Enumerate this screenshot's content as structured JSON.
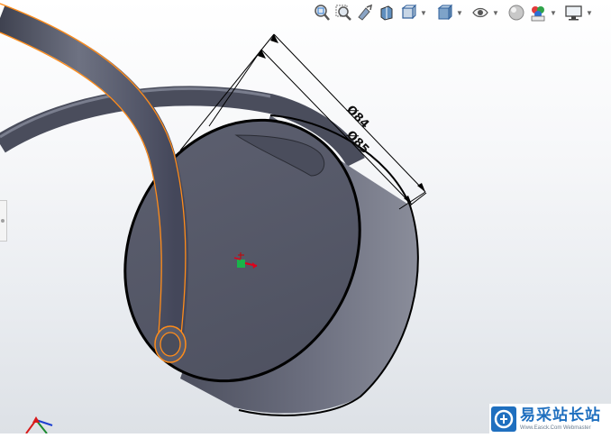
{
  "viewport": {
    "dimensions": [
      {
        "label": "Ø84"
      },
      {
        "label": "Ø85"
      }
    ]
  },
  "heads_up_toolbar": {
    "buttons": [
      {
        "name": "zoom-to-fit",
        "icon": "zoom-to-fit-icon"
      },
      {
        "name": "zoom-to-area",
        "icon": "zoom-to-area-icon"
      },
      {
        "name": "previous-view",
        "icon": "previous-view-icon"
      },
      {
        "name": "section-view",
        "icon": "section-view-icon"
      },
      {
        "name": "view-orientation",
        "icon": "view-orientation-icon",
        "dropdown": true
      },
      {
        "name": "display-style",
        "icon": "display-style-icon",
        "dropdown": true
      },
      {
        "name": "hide-show-items",
        "icon": "eye-icon",
        "dropdown": true
      },
      {
        "name": "edit-appearance",
        "icon": "appearance-sphere-icon",
        "dropdown": true
      },
      {
        "name": "apply-scene",
        "icon": "scene-icon",
        "dropdown": true
      },
      {
        "name": "view-settings",
        "icon": "monitor-icon",
        "dropdown": true
      }
    ]
  },
  "watermark": {
    "title": "易采站长站",
    "subtitle": "Www.Easck.Com Webmaster"
  },
  "colors": {
    "part_face": "#5a5d6b",
    "part_side": "#6b6e7d",
    "edge": "#000000",
    "selected_edge": "#ff8c1a",
    "watermark_blue": "#1f6fbf"
  }
}
